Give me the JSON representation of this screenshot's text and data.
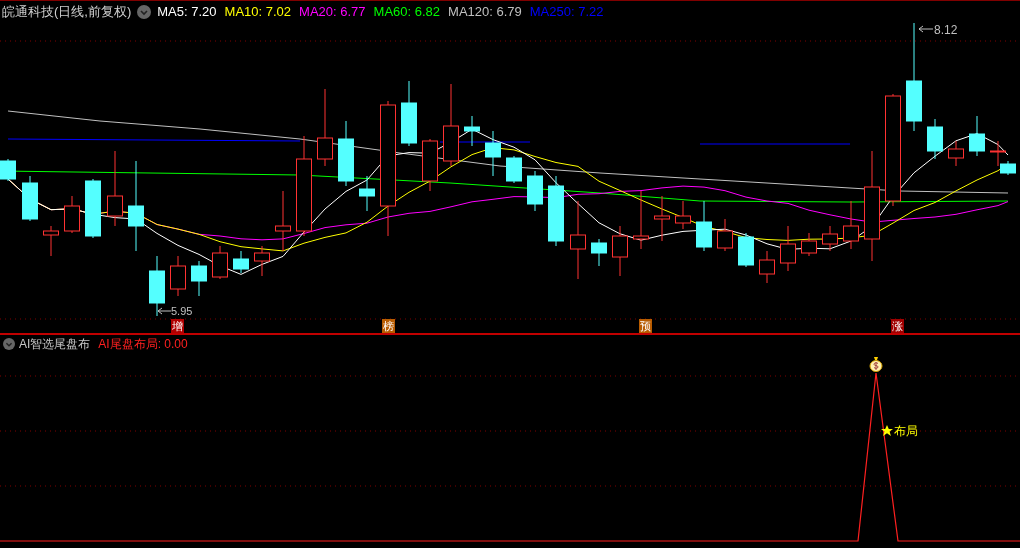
{
  "header": {
    "title": "皖通科技(日线,前复权)",
    "indicators": [
      {
        "label": "MA5: 7.20",
        "color": "#ffffff"
      },
      {
        "label": "MA10: 7.02",
        "color": "#ffff00"
      },
      {
        "label": "MA20: 6.77",
        "color": "#ff00ff"
      },
      {
        "label": "MA60: 6.82",
        "color": "#00ff00"
      },
      {
        "label": "MA120: 6.79",
        "color": "#c0c0c0"
      },
      {
        "label": "MA250: 7.22",
        "color": "#0000ff"
      }
    ]
  },
  "price_chart": {
    "high_label": "8.12",
    "low_label": "5.95",
    "markers": [
      {
        "text": "增",
        "color": "#b00000"
      },
      {
        "text": "榜",
        "color": "#b85c00"
      },
      {
        "text": "预",
        "color": "#b85c00"
      },
      {
        "text": "涨",
        "color": "#a00000"
      }
    ]
  },
  "indicator_panel": {
    "name": "AI智选尾盘布",
    "reading": "AI尾盘布局: 0.00",
    "signal_label": "布局"
  }
}
